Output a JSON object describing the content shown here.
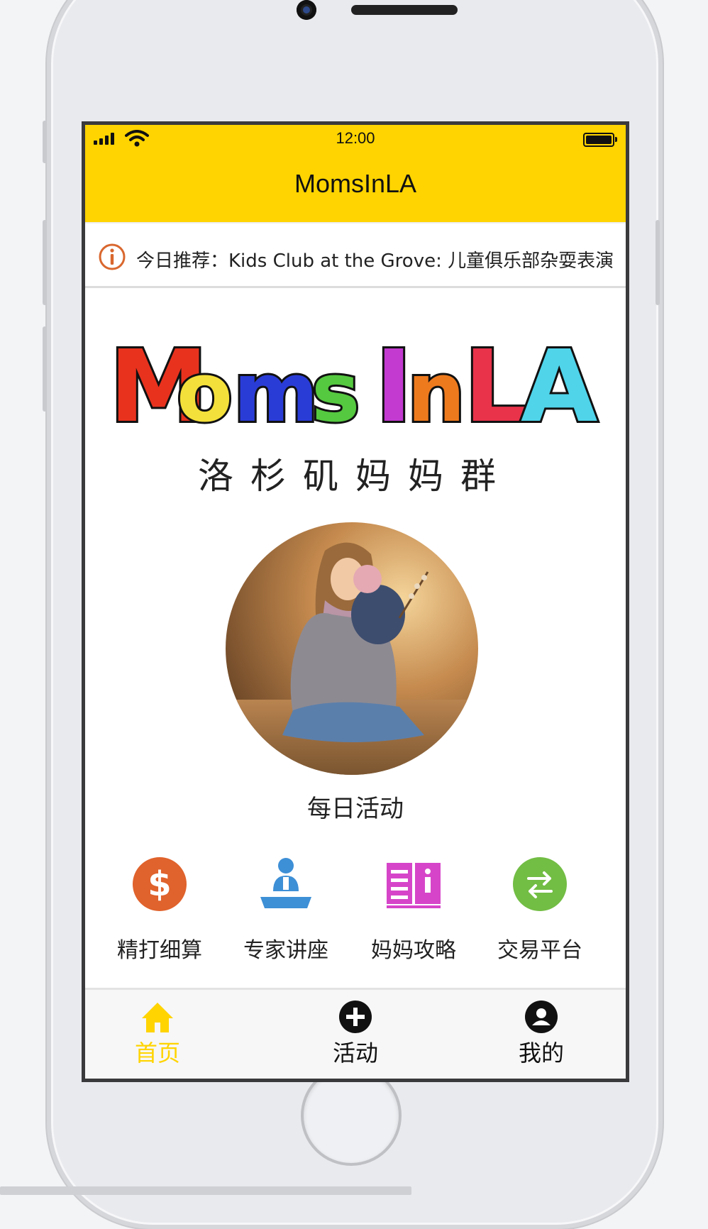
{
  "status_bar": {
    "time": "12:00"
  },
  "header": {
    "title": "MomsInLA"
  },
  "ticker": {
    "text": "今日推荐：Kids Club at the Grove: 儿童俱乐部杂耍表演"
  },
  "logo": {
    "letters": [
      {
        "char": "M",
        "color": "#e8321e"
      },
      {
        "char": "o",
        "color": "#f4e03a"
      },
      {
        "char": "m",
        "color": "#2a3cd6"
      },
      {
        "char": "s",
        "color": "#55c940"
      },
      {
        "char": "I",
        "color": "#c23ad0"
      },
      {
        "char": "n",
        "color": "#ee7a1e"
      },
      {
        "char": "L",
        "color": "#e8334a"
      },
      {
        "char": "A",
        "color": "#4fd4ea"
      }
    ],
    "subtitle": "洛杉矶妈妈群"
  },
  "featured": {
    "label": "每日活动"
  },
  "categories": [
    {
      "label": "精打细算",
      "icon": "dollar-icon",
      "color": "#e0622c"
    },
    {
      "label": "专家讲座",
      "icon": "lecture-icon",
      "color": "#3d8fd6"
    },
    {
      "label": "妈妈攻略",
      "icon": "guide-book-icon",
      "color": "#d645c9"
    },
    {
      "label": "交易平台",
      "icon": "exchange-icon",
      "color": "#72bd44"
    }
  ],
  "tabbar": {
    "active_color": "#ffd400",
    "tabs": [
      {
        "label": "首页",
        "icon": "home-icon",
        "active": true
      },
      {
        "label": "活动",
        "icon": "plus-circle-icon",
        "active": false
      },
      {
        "label": "我的",
        "icon": "user-icon",
        "active": false
      }
    ]
  },
  "colors": {
    "header_bg": "#ffd400",
    "info_icon": "#d9672e"
  }
}
